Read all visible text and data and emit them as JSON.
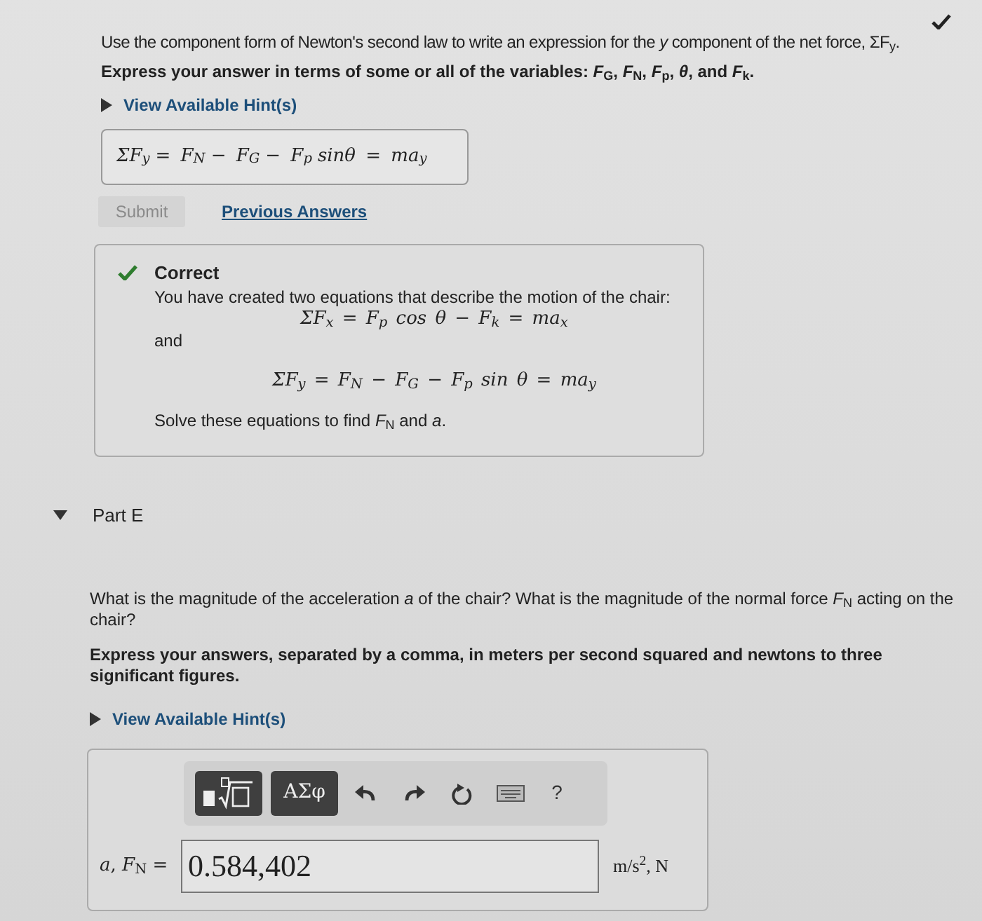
{
  "question": {
    "correct": true,
    "prompt": "Use the component form of Newton's second law to write an expression for the *y* component of the net force, ΣF$_{y}$.",
    "instruction": "Express your answer in terms of some or all of the variables: *F*$_{G}$, *F*$_{N}$, *F*$_{p}$, *θ*, and *F*$_{k}$.",
    "hint_toggle": "View Available Hint(s)",
    "answer": "ΣF$_{y}$ = F$_{N}$ − F$_{G}$ − F$_{p}$sinθ = ma$_{y}$"
  },
  "submit": {
    "label": "Submit",
    "disabled": true
  },
  "previous_answers": "Previous Answers",
  "feedback": {
    "title": "Correct",
    "intro": "You have created two equations that describe the motion of the chair:",
    "equation_1": "ΣF$_{x}$ = F$_{p}$ cos θ − F$_{k}$ = ma$_{x}$",
    "connector": "and",
    "equation_2": "ΣF$_{y}$ = F$_{N}$ − F$_{G}$ − F$_{p}$ sin θ = ma$_{y}$",
    "conclusion": "Solve these equations to find *F*$_{N}$ and *a*."
  },
  "part": {
    "label": "Part E",
    "expanded": true,
    "prompt": "What is the magnitude of the acceleration *a* of the chair? What is the magnitude of the normal force *F*$_{N}$ acting on the chair?",
    "instruction": "Express your answers, separated by a comma, in meters per second squared and newtons to three significant figures.",
    "hint_toggle": "View Available Hint(s)",
    "toolbar": {
      "symbols": "ΑΣφ",
      "help": "?"
    },
    "answer_label": "*a*, *F*$_{N}$ =",
    "value": "0.584,402",
    "units": "m/s$^{2}$, N"
  }
}
